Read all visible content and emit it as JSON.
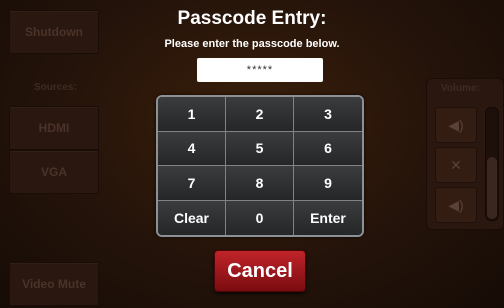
{
  "background": {
    "shutdown_label": "Shutdown",
    "sources_label": "Sources:",
    "hdmi_label": "HDMI",
    "vga_label": "VGA",
    "video_mute_label": "Video Mute",
    "volume_label": "Volume:",
    "volume_level": 0.55
  },
  "dialog": {
    "title": "Passcode Entry:",
    "subtitle": "Please enter the passcode below.",
    "passcode_value": "*****",
    "keys": [
      "1",
      "2",
      "3",
      "4",
      "5",
      "6",
      "7",
      "8",
      "9",
      "Clear",
      "0",
      "Enter"
    ],
    "cancel_label": "Cancel"
  },
  "colors": {
    "cancel_red": "#b01c22",
    "keypad_dark": "#2d2f31",
    "background_brown": "#2a1710"
  }
}
